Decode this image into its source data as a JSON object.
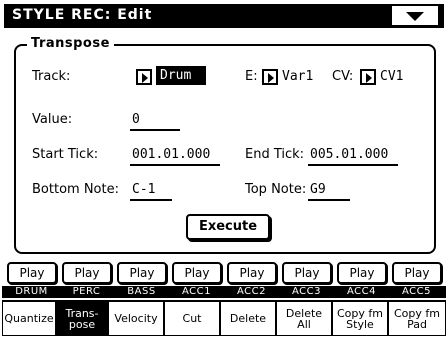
{
  "title": "STYLE REC: Edit",
  "menu_icon": "triangle-down-icon",
  "panel": {
    "title": "Transpose",
    "track_label": "Track:",
    "track_value": "Drum",
    "e_label": "E:",
    "e_value": "Var1",
    "cv_label": "CV:",
    "cv_value": "CV1",
    "value_label": "Value:",
    "value_value": "0",
    "start_label": "Start Tick:",
    "start_value": "001.01.000",
    "end_label": "End Tick:",
    "end_value": "005.01.000",
    "bottom_label": "Bottom Note:",
    "bottom_value": "C-1",
    "top_label": "Top Note:",
    "top_value": "G9",
    "execute_label": "Execute"
  },
  "play_buttons": [
    "Play",
    "Play",
    "Play",
    "Play",
    "Play",
    "Play",
    "Play",
    "Play"
  ],
  "tracks": [
    "DRUM",
    "PERC",
    "BASS",
    "ACC1",
    "ACC2",
    "ACC3",
    "ACC4",
    "ACC5"
  ],
  "tabs": [
    {
      "label": "Quantize",
      "active": false
    },
    {
      "label": "Trans-\npose",
      "active": true
    },
    {
      "label": "Velocity",
      "active": false
    },
    {
      "label": "Cut",
      "active": false
    },
    {
      "label": "Delete",
      "active": false
    },
    {
      "label": "Delete\nAll",
      "active": false
    },
    {
      "label": "Copy fm\nStyle",
      "active": false
    },
    {
      "label": "Copy fm\nPad",
      "active": false
    }
  ]
}
